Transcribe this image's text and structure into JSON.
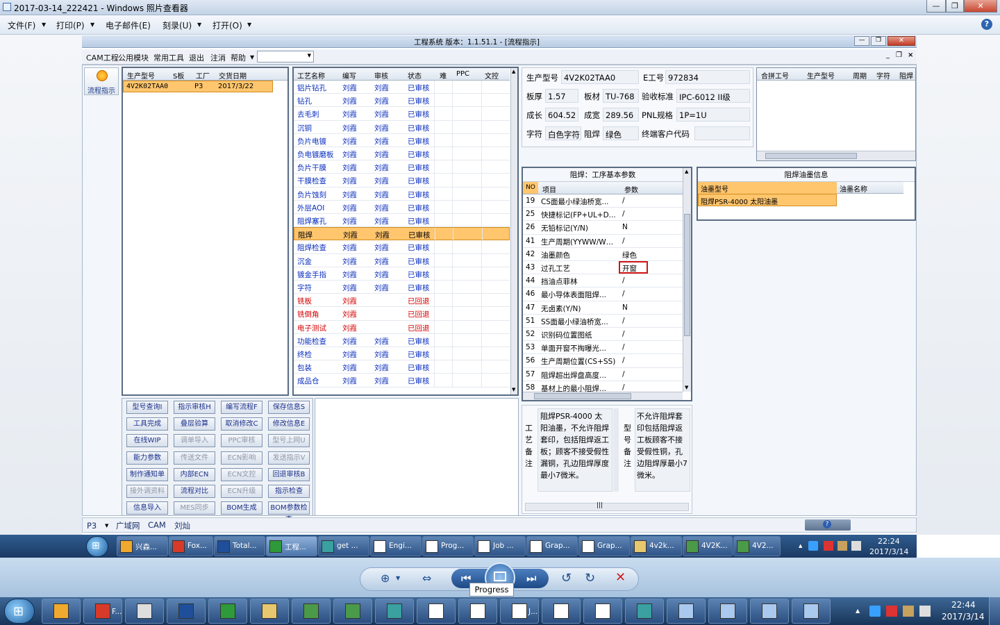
{
  "viewer": {
    "title": "2017-03-14_222421 - Windows 照片查看器",
    "menu": [
      "文件(F)",
      "打印(P)",
      "电子邮件(E)",
      "刻录(U)",
      "打开(O)"
    ],
    "tooltip": "Progress"
  },
  "app": {
    "title": "工程系统   版本：1.1.51.1 - [流程指示]",
    "menu": [
      "CAM工程",
      "公用模块",
      "常用工具",
      "退出",
      "注消",
      "帮助"
    ],
    "left_tab": "流程指示",
    "order_headers": [
      "生产型号",
      "S板",
      "工厂",
      "交货日期"
    ],
    "order_row": [
      "4V2K02TAA0",
      "P3",
      "2017/3/22"
    ],
    "process_headers": [
      "工艺名称",
      "编写",
      "审核",
      "状态",
      "难",
      "PPC",
      "文控"
    ],
    "process_rows": [
      {
        "name": "铝片钻孔",
        "w": "刘霞",
        "r": "刘霞",
        "s": "已审核",
        "c": "blue"
      },
      {
        "name": "钻孔",
        "w": "刘霞",
        "r": "刘霞",
        "s": "已审核",
        "c": "blue"
      },
      {
        "name": "去毛刺",
        "w": "刘霞",
        "r": "刘霞",
        "s": "已审核",
        "c": "blue"
      },
      {
        "name": "沉铜",
        "w": "刘霞",
        "r": "刘霞",
        "s": "已审核",
        "c": "blue"
      },
      {
        "name": "负片电镀",
        "w": "刘霞",
        "r": "刘霞",
        "s": "已审核",
        "c": "blue"
      },
      {
        "name": "负电镀磨板",
        "w": "刘霞",
        "r": "刘霞",
        "s": "已审核",
        "c": "blue"
      },
      {
        "name": "负片干膜",
        "w": "刘霞",
        "r": "刘霞",
        "s": "已审核",
        "c": "blue"
      },
      {
        "name": "干膜检查",
        "w": "刘霞",
        "r": "刘霞",
        "s": "已审核",
        "c": "blue"
      },
      {
        "name": "负片蚀刻",
        "w": "刘霞",
        "r": "刘霞",
        "s": "已审核",
        "c": "blue"
      },
      {
        "name": "外层AOI",
        "w": "刘霞",
        "r": "刘霞",
        "s": "已审核",
        "c": "blue"
      },
      {
        "name": "阻焊塞孔",
        "w": "刘霞",
        "r": "刘霞",
        "s": "已审核",
        "c": "blue"
      },
      {
        "name": "阻焊",
        "w": "刘霞",
        "r": "刘霞",
        "s": "已审核",
        "c": "sel"
      },
      {
        "name": "阻焊检查",
        "w": "刘霞",
        "r": "刘霞",
        "s": "已审核",
        "c": "blue"
      },
      {
        "name": "沉金",
        "w": "刘霞",
        "r": "刘霞",
        "s": "已审核",
        "c": "blue"
      },
      {
        "name": "镀金手指",
        "w": "刘霞",
        "r": "刘霞",
        "s": "已审核",
        "c": "blue"
      },
      {
        "name": "字符",
        "w": "刘霞",
        "r": "刘霞",
        "s": "已审核",
        "c": "blue"
      },
      {
        "name": "铣板",
        "w": "刘霞",
        "r": "",
        "s": "已回退",
        "c": "red"
      },
      {
        "name": "铣倒角",
        "w": "刘霞",
        "r": "",
        "s": "已回退",
        "c": "red"
      },
      {
        "name": "电子测试",
        "w": "刘霞",
        "r": "",
        "s": "已回退",
        "c": "red"
      },
      {
        "name": "功能检查",
        "w": "刘霞",
        "r": "刘霞",
        "s": "已审核",
        "c": "blue"
      },
      {
        "name": "终检",
        "w": "刘霞",
        "r": "刘霞",
        "s": "已审核",
        "c": "blue"
      },
      {
        "name": "包装",
        "w": "刘霞",
        "r": "刘霞",
        "s": "已审核",
        "c": "blue"
      },
      {
        "name": "成品仓",
        "w": "刘霞",
        "r": "刘霞",
        "s": "已审核",
        "c": "blue"
      }
    ],
    "buttons": [
      [
        "型号查询I",
        "指示审核H",
        "编写流程F",
        "保存信息S"
      ],
      [
        "工具完成",
        "叠层验算",
        "取消修改C",
        "修改信息E"
      ],
      [
        "在线WIP",
        "调单导入",
        "PPC审核",
        "型号上网U"
      ],
      [
        "能力参数",
        "传送文件",
        "ECN影响",
        "发送指示V"
      ],
      [
        "制作通知单",
        "内部ECN",
        "ECN文控",
        "回退审核B"
      ],
      [
        "接外调资料",
        "流程对比",
        "ECN升级",
        "指示检查"
      ],
      [
        "信息导入",
        "MES同步",
        "BOM生成",
        "BOM参数检查"
      ]
    ],
    "button_disabled": [
      [
        false,
        false,
        false,
        false
      ],
      [
        false,
        false,
        false,
        false
      ],
      [
        false,
        true,
        true,
        true
      ],
      [
        false,
        true,
        true,
        true
      ],
      [
        false,
        false,
        true,
        false
      ],
      [
        true,
        false,
        true,
        false
      ],
      [
        false,
        true,
        false,
        false
      ]
    ],
    "info": {
      "r1": [
        "生产型号",
        "4V2K02TAA0",
        "E工号",
        "972834"
      ],
      "r2": [
        "板厚",
        "1.57",
        "板材",
        "TU-768",
        "验收标准",
        "IPC-6012 II级"
      ],
      "r3": [
        "成长",
        "604.52",
        "成宽",
        "289.56",
        "PNL规格",
        "1P=1U"
      ],
      "r4": [
        "字符",
        "白色字符",
        "阻焊",
        "绿色",
        "终端客户代码",
        ""
      ]
    },
    "merge_headers": [
      "合拼工号",
      "生产型号",
      "周期",
      "字符",
      "阻焊"
    ],
    "param_title": "阻焊：工序基本参数",
    "param_headers": [
      "NO",
      "项目",
      "参数"
    ],
    "params": [
      [
        "19",
        "CS面最小绿油桥宽...",
        "/"
      ],
      [
        "25",
        "快捷标记(FP+UL+D...",
        "/"
      ],
      [
        "26",
        "无铅标记(Y/N)",
        "N"
      ],
      [
        "41",
        "生产周期(YYWW/WWYY)",
        "/"
      ],
      [
        "42",
        "油墨颜色",
        "绿色"
      ],
      [
        "43",
        "过孔工艺",
        "开窗"
      ],
      [
        "44",
        "挡油点菲林",
        "/"
      ],
      [
        "46",
        "最小导体表面阻焊...",
        "/"
      ],
      [
        "47",
        "无卤素(Y/N)",
        "N"
      ],
      [
        "51",
        "SS面最小绿油桥宽...",
        "/"
      ],
      [
        "52",
        "识别码位置图纸",
        "/"
      ],
      [
        "53",
        "单面开窗不掏曝光...",
        "/"
      ],
      [
        "56",
        "生产周期位置(CS+SS)",
        "/"
      ],
      [
        "57",
        "阻焊超出焊盘高度...",
        "/"
      ],
      [
        "58",
        "基材上的最小阻焊...",
        "/"
      ]
    ],
    "ink_title": "阻焊油墨信息",
    "ink_headers": [
      "油墨型号",
      "油墨名称"
    ],
    "ink_row": [
      "阻焊PSR-4000 太阳油墨",
      ""
    ],
    "note1_label": "工艺备注",
    "note1": "阻焊PSR-4000 太阳油墨，不允许阻焊套印，包括阻焊返工板；顾客不接受假性漏铜，孔边阻焊厚度最小7微米。",
    "note2_label": "型号备注",
    "note2": "不允许阻焊套印包括阻焊返工板顾客不接受假性铜，孔边阻焊厚最小7微米。",
    "status": [
      "P3",
      "广域网",
      "CAM",
      "刘灿"
    ]
  },
  "taskbar1": {
    "items": [
      "兴森...",
      "Fox...",
      "Total...",
      "工程...",
      "get ...",
      "Engi...",
      "Prog...",
      "Job ...",
      "Grap...",
      "Grap...",
      "4v2k...",
      "4V2K...",
      "4V2..."
    ],
    "time": "22:24",
    "date": "2017/3/14"
  },
  "taskbar2": {
    "items": [
      "F...",
      "J..."
    ],
    "time": "22:44",
    "date": "2017/3/14"
  }
}
